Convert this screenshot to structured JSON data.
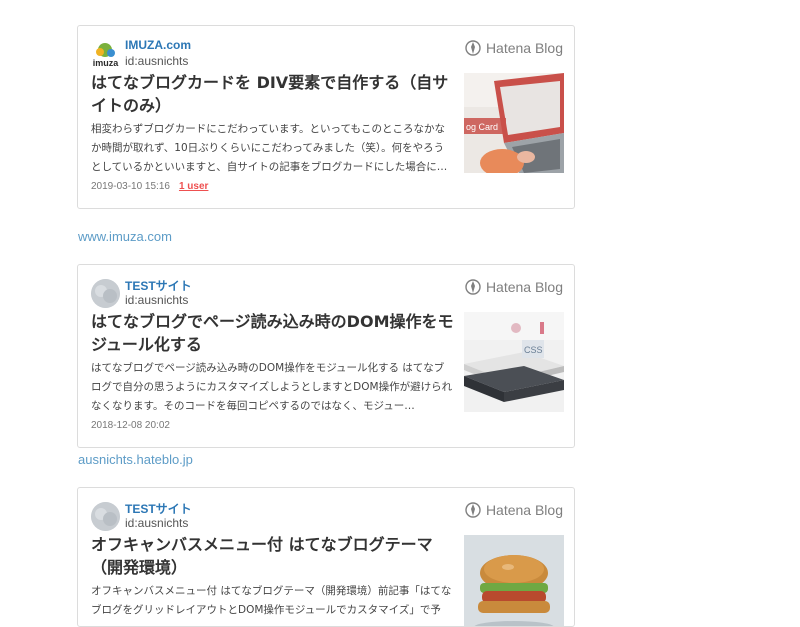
{
  "colors": {
    "site_name": "#2c77b5",
    "source_link": "#5d9cc7",
    "bookmark": "#ee5050",
    "card_border": "#dcdcdc"
  },
  "cards": [
    {
      "site_name": "IMUZA.com",
      "icon_text": "imuza",
      "user": "id:ausnichts",
      "brand": "Hatena Blog",
      "title": "はてなブログカードを DIV要素で自作する（自サイトのみ）",
      "description": "相変わらずブログカードにこだわっています。といってもこのところなかなか時間が取れず、10日ぶりくらいにこだわってみました（笑）。何をやろうとしているかといいますと、自サイトの記事をブログカードにした場合に…",
      "date": "2019-03-10 15:16",
      "bookmarks": "1 user",
      "thumb_text": "og Card",
      "thumb_icon": "laptop-photo"
    },
    {
      "site_name": "TESTサイト",
      "user": "id:ausnichts",
      "brand": "Hatena Blog",
      "title": "はてなブログでページ読み込み時のDOM操作をモジュール化する",
      "description": "はてなブログでページ読み込み時のDOM操作をモジュール化する はてなブログで自分の思うようにカスタマイズしようとしますとDOM操作が避けられなくなります。そのコードを毎回コピペするのではなく、モジュー…",
      "date": "2018-12-08 20:02",
      "thumb_icon": "books-photo"
    },
    {
      "site_name": "TESTサイト",
      "user": "id:ausnichts",
      "brand": "Hatena Blog",
      "title": "オフキャンバスメニュー付 はてなブログテーマ（開発環境）",
      "description": "オフキャンバスメニュー付 はてなブログテーマ（開発環境）前記事「はてなブログをグリッドレイアウトとDOM操作モジュールでカスタマイズ」で予",
      "thumb_icon": "burger-photo"
    }
  ],
  "sources": [
    "www.imuza.com",
    "ausnichts.hateblo.jp"
  ]
}
